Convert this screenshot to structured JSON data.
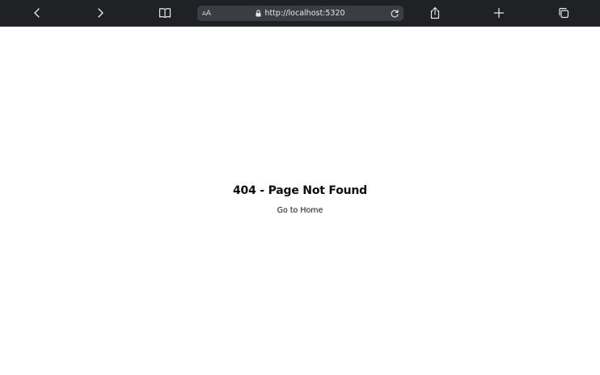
{
  "browser": {
    "address": {
      "text_size_label_small": "A",
      "text_size_label_large": "A",
      "url": "http://localhost:5320"
    },
    "icons": {
      "back": "chevron-left-icon",
      "forward": "chevron-right-icon",
      "reader": "book-icon",
      "lock": "lock-icon",
      "reload": "reload-icon",
      "share": "share-icon",
      "new_tab": "plus-icon",
      "tabs": "tabs-icon"
    },
    "colors": {
      "toolbar_bg": "#1f2124",
      "address_bg": "#3a3d42",
      "icon": "#e6e6e6"
    }
  },
  "page": {
    "title": "404 - Page Not Found",
    "home_link": "Go to Home"
  }
}
